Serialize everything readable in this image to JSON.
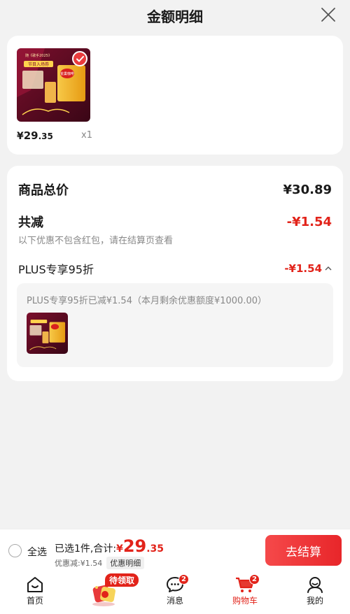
{
  "header": {
    "title": "金额明细",
    "close_icon": "close-icon"
  },
  "product": {
    "currency": "¥",
    "price_int": "29",
    "price_dec": ".35",
    "quantity": "x1",
    "image_top_text": "随《歌手2025》",
    "image_banner_text": "节目入场券",
    "image_can_text": "雀巢咖啡"
  },
  "summary": {
    "total_label": "商品总价",
    "total_value": "¥30.89",
    "reduce_label": "共减",
    "reduce_value": "-¥1.54",
    "note": "以下优惠不包含红包，请在结算页查看",
    "plus_label": "PLUS专享95折",
    "plus_value": "-¥1.54",
    "plus_detail": "PLUS专享95折已减¥1.54（本月剩余优惠额度¥1000.00）"
  },
  "bottom_bar": {
    "select_all": "全选",
    "selected_text": "已选1件,合计:",
    "total_cur": "¥",
    "total_int": "29",
    "total_dec": ".35",
    "discount_text": "优惠减:¥1.54",
    "detail_button": "优惠明细",
    "checkout_button": "去结算"
  },
  "tabbar": {
    "home": "首页",
    "promo_pill": "待领取",
    "messages": "消息",
    "messages_badge": "2",
    "cart": "购物车",
    "cart_badge": "2",
    "mine": "我的"
  },
  "colors": {
    "accent": "#e2231a",
    "background": "#f2f2f2",
    "card": "#ffffff"
  }
}
